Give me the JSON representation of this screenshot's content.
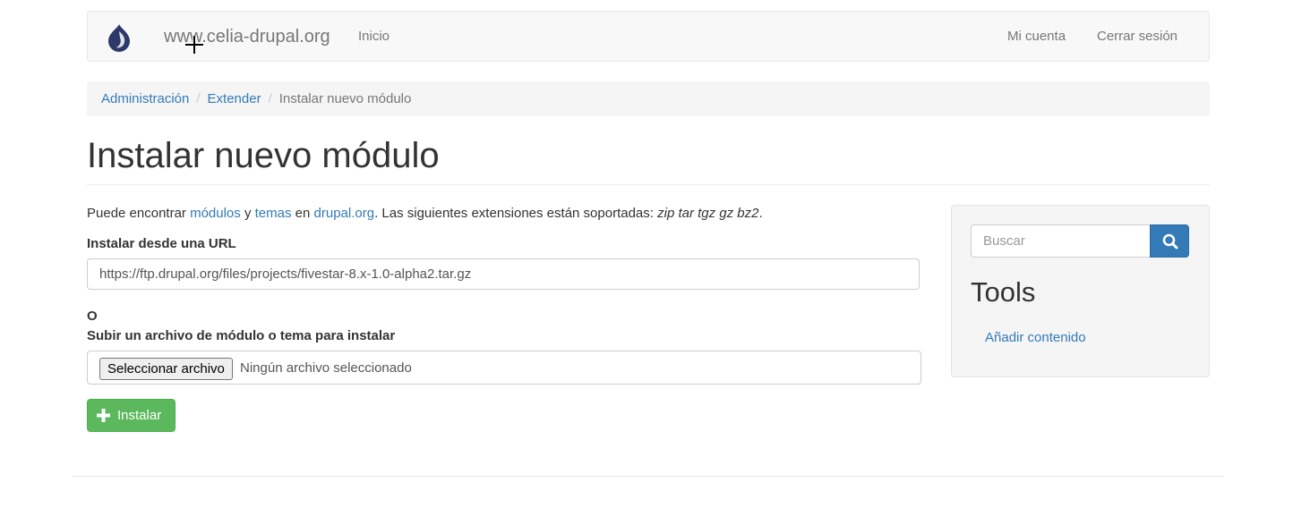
{
  "navbar": {
    "site_name": "www.celia-drupal.org",
    "home": "Inicio",
    "account": "Mi cuenta",
    "logout": "Cerrar sesión",
    "logo_icon": "drupal-drop-icon"
  },
  "breadcrumb": {
    "items": [
      "Administración",
      "Extender",
      "Instalar nuevo módulo"
    ],
    "separator": "/"
  },
  "page": {
    "title": "Instalar nuevo módulo"
  },
  "intro": {
    "prefix": "Puede encontrar ",
    "modules_link": "módulos",
    "and": " y ",
    "themes_link": "temas",
    "in": " en ",
    "drupal_link": "drupal.org",
    "suffix": ". Las siguientes extensiones están soportadas: ",
    "extensions": "zip tar tgz gz bz2",
    "end": "."
  },
  "form": {
    "url_label": "Instalar desde una URL",
    "url_value": "https://ftp.drupal.org/files/projects/fivestar-8.x-1.0-alpha2.tar.gz",
    "or_label": "O",
    "upload_label": "Subir un archivo de módulo o tema para instalar",
    "file_button": "Seleccionar archivo",
    "file_status": "Ningún archivo seleccionado",
    "install_button": "Instalar"
  },
  "sidebar": {
    "search_placeholder": "Buscar",
    "tools_title": "Tools",
    "tools_link": "Añadir contenido"
  },
  "colors": {
    "link": "#337ab7",
    "success": "#5cb85c",
    "primary": "#337ab7"
  }
}
